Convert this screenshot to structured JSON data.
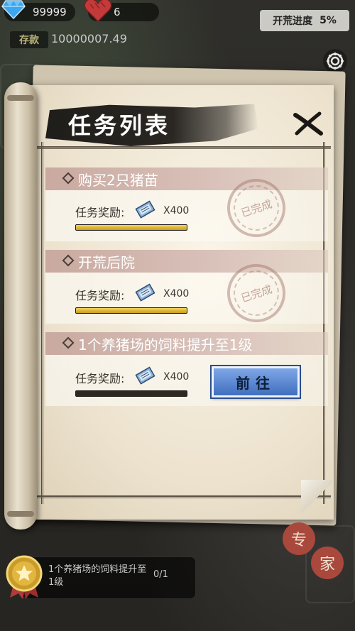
{
  "hud": {
    "gems": "99999",
    "hearts": "6",
    "deposit_label": "存款",
    "deposit_value": "10000007.49",
    "progress_label": "开荒进度",
    "progress_value": "5%"
  },
  "dialog": {
    "title": "任务列表",
    "tasks": [
      {
        "title": "购买2只猪苗",
        "reward_label": "任务奖励:",
        "reward_qty": "X400",
        "progress": 1.0,
        "completed": true,
        "stamp_text": "已完成"
      },
      {
        "title": "开荒后院",
        "reward_label": "任务奖励:",
        "reward_qty": "X400",
        "progress": 1.0,
        "completed": true,
        "stamp_text": "已完成"
      },
      {
        "title": "1个养猪场的饲料提升至1级",
        "reward_label": "任务奖励:",
        "reward_qty": "X400",
        "progress": 0.0,
        "completed": false,
        "action_label": "前往"
      }
    ]
  },
  "bottom": {
    "current_task": "1个养猪场的饲料提升至1级",
    "current_count": "0/1",
    "expert_chars": [
      "专",
      "家"
    ]
  },
  "colors": {
    "accent_blue": "#3f6fbf",
    "progress_gold": "#e0b636",
    "stamp_red": "#a06e64",
    "header_rose": "#c9a9a0"
  },
  "icons": [
    "gem-icon",
    "heart-icon",
    "gear-icon",
    "close-icon",
    "ticket-icon",
    "medal-icon"
  ]
}
